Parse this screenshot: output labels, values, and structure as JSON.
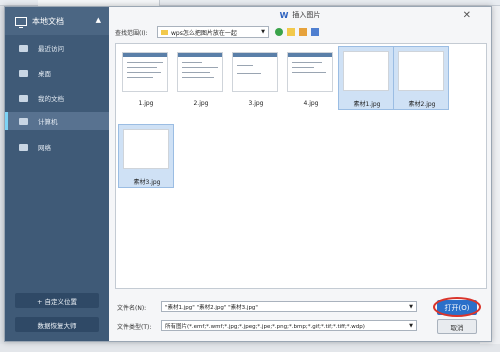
{
  "background": {
    "doc_tab_label": "wps图片.docx"
  },
  "sidebar": {
    "title": "本地文档",
    "items": [
      {
        "label": "最近访问",
        "icon": "clock-icon"
      },
      {
        "label": "桌面",
        "icon": "desktop-icon"
      },
      {
        "label": "我的文档",
        "icon": "folder-icon"
      },
      {
        "label": "计算机",
        "icon": "computer-icon"
      },
      {
        "label": "网络",
        "icon": "network-icon"
      }
    ],
    "active_item": "计算机",
    "custom_location_label": "+ 自定义位置",
    "data_recovery_label": "数据恢复大师"
  },
  "dialog": {
    "title": "插入图片",
    "look_in_label": "查找范围(I):",
    "look_in_value": "wps怎么把图片放在一起"
  },
  "files": [
    {
      "name": "1.jpg",
      "kind": "document",
      "selected": false
    },
    {
      "name": "2.jpg",
      "kind": "document",
      "selected": false
    },
    {
      "name": "3.jpg",
      "kind": "document",
      "selected": false
    },
    {
      "name": "4.jpg",
      "kind": "document",
      "selected": false
    },
    {
      "name": "素材1.jpg",
      "kind": "beach",
      "selected": true
    },
    {
      "name": "素材2.jpg",
      "kind": "island",
      "selected": true
    },
    {
      "name": "素材3.jpg",
      "kind": "sunset",
      "selected": true
    }
  ],
  "bottom": {
    "filename_label": "文件名(N):",
    "filename_value": "\"素材1.jpg\" \"素材2.jpg\" \"素材3.jpg\"",
    "filetype_label": "文件类型(T):",
    "filetype_value": "所有图片(*.emf;*.wmf;*.jpg;*.jpeg;*.jpe;*.png;*.bmp;*.gif;*.tif;*.tiff;*.wdp)",
    "open_label": "打开(O)",
    "cancel_label": "取消"
  },
  "colors": {
    "sidebar_bg": "#3f5a77",
    "accent": "#2a6fc9",
    "selection": "#cfe1f5",
    "highlight_ring": "#d9342b"
  }
}
